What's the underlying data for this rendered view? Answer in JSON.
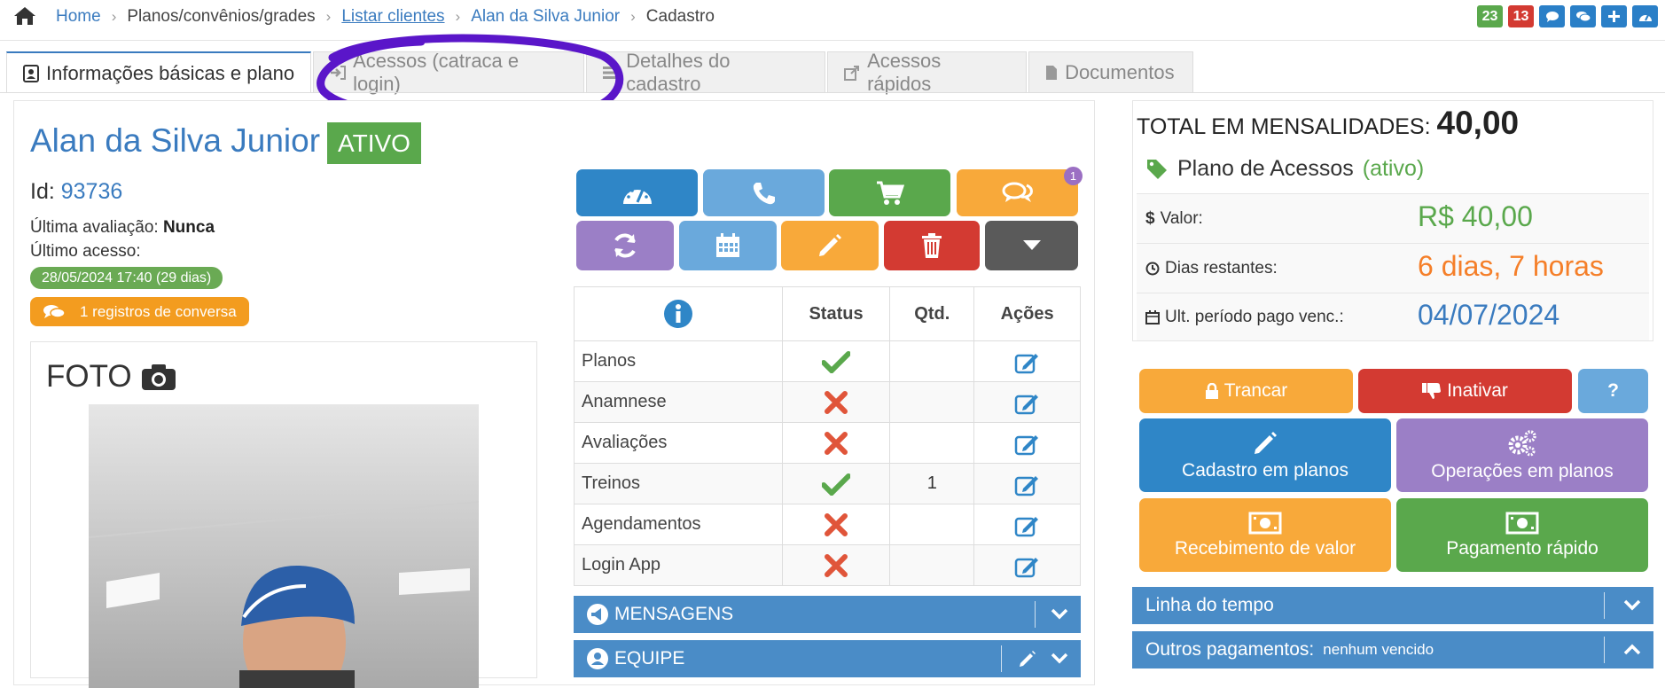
{
  "breadcrumb": {
    "home": "Home",
    "items": [
      "Planos/convênios/grades",
      "Listar clientes",
      "Alan da Silva Junior",
      "Cadastro"
    ]
  },
  "badges": {
    "green": "23",
    "red": "13"
  },
  "tabs": [
    {
      "label": "Informações básicas e plano",
      "icon": "id-card-icon"
    },
    {
      "label": "Acessos (catraca e login)",
      "icon": "sign-in-icon"
    },
    {
      "label": "Detalhes do cadastro",
      "icon": "list-icon"
    },
    {
      "label": "Acessos rápidos",
      "icon": "external-link-icon"
    },
    {
      "label": "Documentos",
      "icon": "file-icon"
    }
  ],
  "client": {
    "name": "Alan da Silva Junior",
    "status": "ATIVO",
    "id_label": "Id:",
    "id": "93736",
    "last_eval_label": "Última avaliação:",
    "last_eval": "Nunca",
    "last_access_label": "Último acesso:",
    "last_access": "28/05/2024 17:40 (29 dias)",
    "conversations": "1 registros de conversa",
    "photo_title": "FOTO"
  },
  "action_notification": "1",
  "status_table": {
    "headers": [
      "Status",
      "Qtd.",
      "Ações"
    ],
    "rows": [
      {
        "label": "Planos",
        "ok": true,
        "qtd": ""
      },
      {
        "label": "Anamnese",
        "ok": false,
        "qtd": ""
      },
      {
        "label": "Avaliações",
        "ok": false,
        "qtd": ""
      },
      {
        "label": "Treinos",
        "ok": true,
        "qtd": "1"
      },
      {
        "label": "Agendamentos",
        "ok": false,
        "qtd": ""
      },
      {
        "label": "Login App",
        "ok": false,
        "qtd": ""
      }
    ]
  },
  "sections": {
    "mensagens": "MENSAGENS",
    "equipe": "EQUIPE"
  },
  "summary": {
    "total_label": "TOTAL EM MENSALIDADES:",
    "total_value": "40,00",
    "plan_name": "Plano de Acessos",
    "plan_status": "(ativo)",
    "valor_label": "Valor:",
    "valor": "R$ 40,00",
    "dias_label": "Dias restantes:",
    "dias": "6 dias, 7 horas",
    "ult_label": "Ult. período pago venc.:",
    "ult": "04/07/2024"
  },
  "buttons": {
    "trancar": "Trancar",
    "inativar": "Inativar",
    "help": "?",
    "cadastro": "Cadastro em planos",
    "operacoes": "Operações em planos",
    "recebimento": "Recebimento de valor",
    "pagamento": "Pagamento rápido"
  },
  "timeline": {
    "linha": "Linha do tempo",
    "outros": "Outros pagamentos:",
    "outros_status": "nenhum vencido"
  },
  "colors": {
    "primary": "#3a7bbf",
    "success": "#5aa84c",
    "danger": "#d33a32",
    "warning": "#f8a93a",
    "purple": "#9b7fc6",
    "light_blue": "#6aa9dc",
    "annotation": "#5a16c9"
  }
}
